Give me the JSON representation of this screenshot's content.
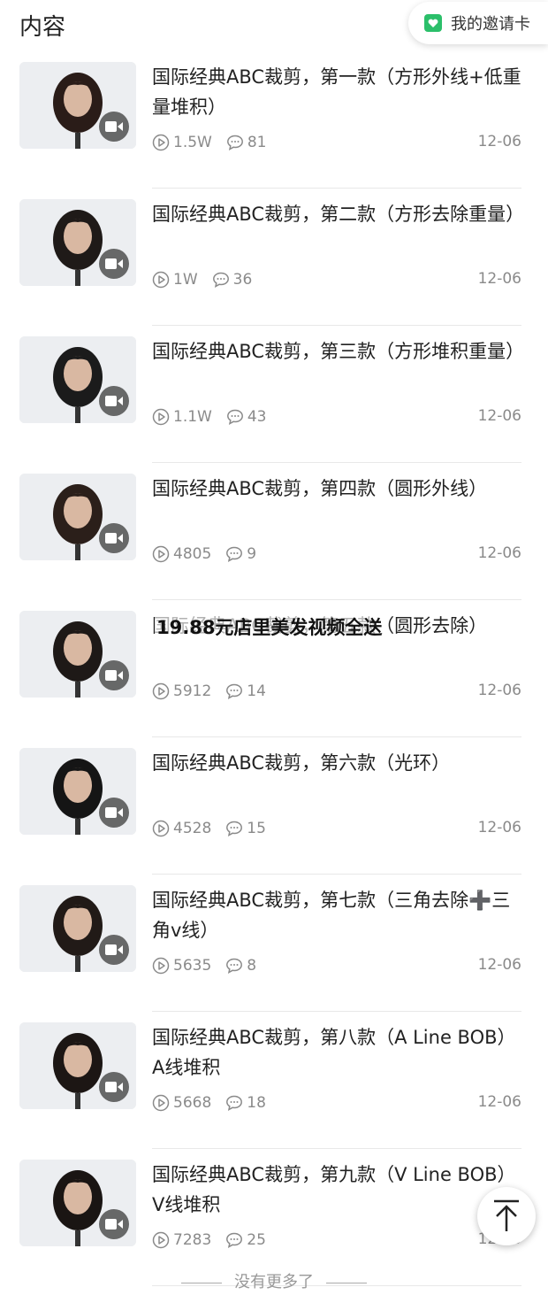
{
  "header": {
    "title": "内容",
    "invite_label": "我的邀请卡"
  },
  "items": [
    {
      "title": "国际经典ABC裁剪，第一款（方形外线+低重量堆积）",
      "views": "1.5W",
      "comments": "81",
      "date": "12-06"
    },
    {
      "title": "国际经典ABC裁剪，第二款（方形去除重量）",
      "views": "1W",
      "comments": "36",
      "date": "12-06"
    },
    {
      "title": "国际经典ABC裁剪，第三款（方形堆积重量）",
      "views": "1.1W",
      "comments": "43",
      "date": "12-06"
    },
    {
      "title": "国际经典ABC裁剪，第四款（圆形外线）",
      "views": "4805",
      "comments": "9",
      "date": "12-06"
    },
    {
      "title": "国际经典ABC裁剪，第五款（圆形去除）",
      "views": "5912",
      "comments": "14",
      "date": "12-06"
    },
    {
      "title": "国际经典ABC裁剪，第六款（光环）",
      "views": "4528",
      "comments": "15",
      "date": "12-06"
    },
    {
      "title": "国际经典ABC裁剪，第七款（三角去除➕三角v线）",
      "views": "5635",
      "comments": "8",
      "date": "12-06"
    },
    {
      "title": "国际经典ABC裁剪，第八款（A Line BOB）A线堆积",
      "views": "5668",
      "comments": "18",
      "date": "12-06"
    },
    {
      "title": "国际经典ABC裁剪，第九款（V Line BOB）V线堆积",
      "views": "7283",
      "comments": "25",
      "date": "12-06"
    }
  ],
  "overlay_text": "19.88元店里美发视频全送",
  "footer": {
    "no_more": "没有更多了"
  }
}
